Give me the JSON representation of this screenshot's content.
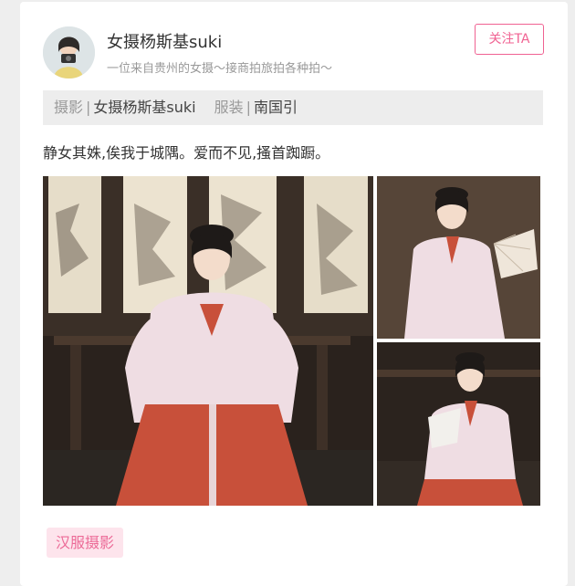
{
  "post": {
    "author_name": "女摄杨斯基suki",
    "author_bio": "一位来自贵州的女摄～接商拍旅拍各种拍～",
    "follow_label": "关注TA",
    "credits": [
      {
        "key": "摄影",
        "sep": "|",
        "value": "女摄杨斯基suki"
      },
      {
        "key": "服装",
        "sep": "|",
        "value": "南国引"
      }
    ],
    "caption": "静女其姝,俟我于城隅。爱而不见,搔首踟蹰。",
    "tag": "汉服摄影",
    "colors": {
      "accent": "#f06292",
      "tag_bg": "#fde4ec",
      "tag_text": "#ec6a97",
      "hanfu_top": "#efdde3",
      "hanfu_skirt": "#c8503a"
    }
  }
}
